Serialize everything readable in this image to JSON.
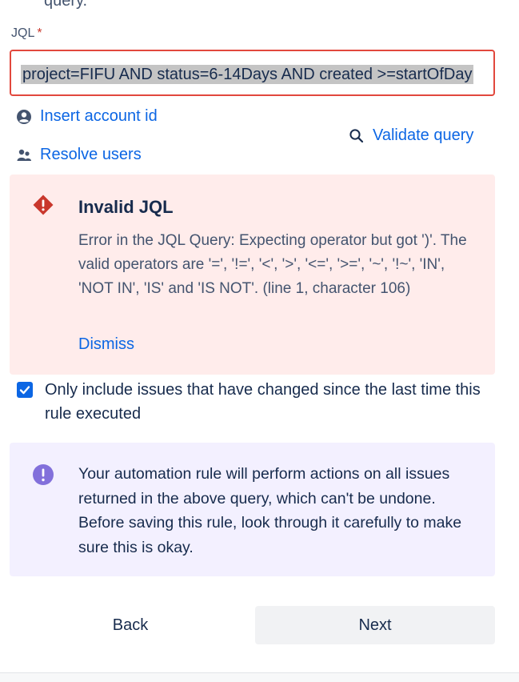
{
  "top_fragment": "query.",
  "jql": {
    "label": "JQL",
    "required_mark": "*",
    "value": "project=FIFU AND status=6-14Days AND created >=startOfDay"
  },
  "links": {
    "insert_account_id": "Insert account id",
    "resolve_users": "Resolve users",
    "validate_query": "Validate query"
  },
  "error": {
    "title": "Invalid JQL",
    "message": "Error in the JQL Query: Expecting operator but got ')'. The valid operators are '=', '!=', '<', '>', '<=', '>=', '~', '!~', 'IN', 'NOT IN', 'IS' and 'IS NOT'. (line 1, character 106)",
    "dismiss": "Dismiss"
  },
  "only_changed": {
    "checked": true,
    "label": "Only include issues that have changed since the last time this rule executed"
  },
  "info": {
    "message": "Your automation rule will perform actions on all issues returned in the above query, which can't be undone. Before saving this rule, look through it carefully to make sure this is okay."
  },
  "buttons": {
    "back": "Back",
    "next": "Next"
  },
  "colors": {
    "link": "#0c66e4",
    "error_bg": "#ffeceb",
    "error_icon": "#c9372c",
    "info_bg": "#f3f0ff",
    "info_icon": "#8270db"
  }
}
